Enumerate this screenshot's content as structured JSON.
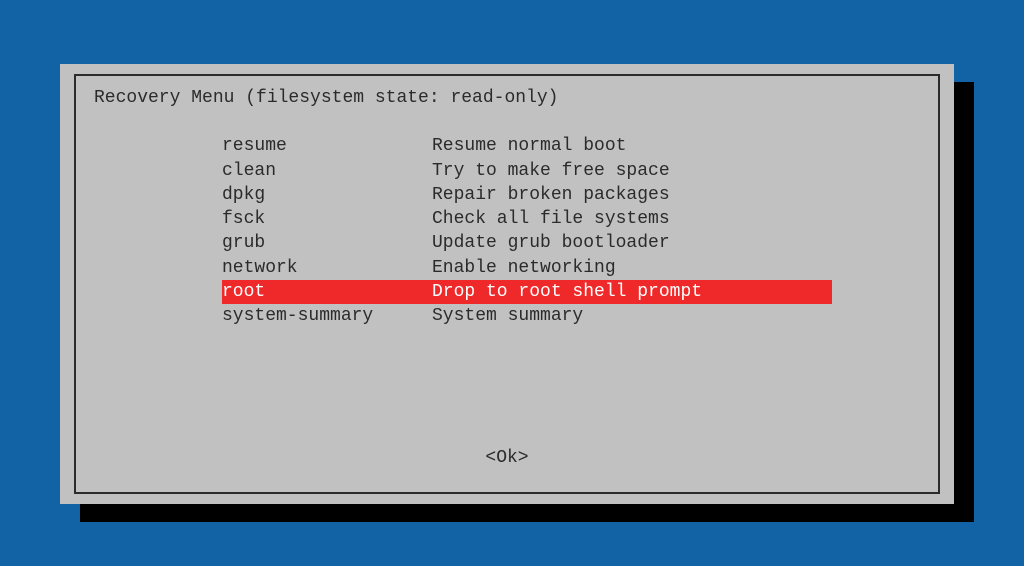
{
  "dialog": {
    "title": "Recovery Menu (filesystem state: read-only)",
    "items": [
      {
        "key": "resume",
        "desc": "Resume normal boot",
        "selected": false
      },
      {
        "key": "clean",
        "desc": "Try to make free space",
        "selected": false
      },
      {
        "key": "dpkg",
        "desc": "Repair broken packages",
        "selected": false
      },
      {
        "key": "fsck",
        "desc": "Check all file systems",
        "selected": false
      },
      {
        "key": "grub",
        "desc": "Update grub bootloader",
        "selected": false
      },
      {
        "key": "network",
        "desc": "Enable networking",
        "selected": false
      },
      {
        "key": "root",
        "desc": "Drop to root shell prompt",
        "selected": true
      },
      {
        "key": "system-summary",
        "desc": "System summary",
        "selected": false
      }
    ],
    "ok_label": "<Ok>"
  },
  "colors": {
    "background": "#1163a6",
    "panel": "#c1c1c1",
    "text": "#2b2b2b",
    "highlight_bg": "#ef2929",
    "highlight_fg": "#ffffff"
  }
}
